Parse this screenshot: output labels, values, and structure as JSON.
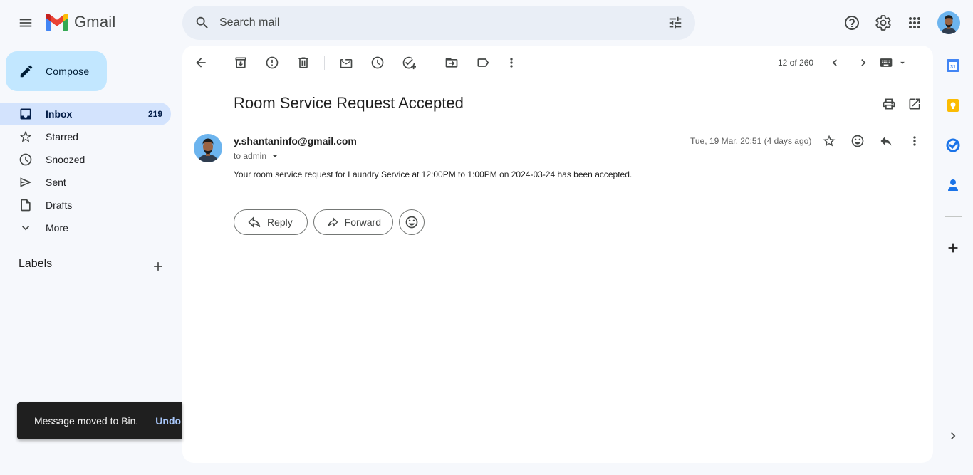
{
  "header": {
    "app_name": "Gmail",
    "search_placeholder": "Search mail"
  },
  "sidebar": {
    "compose_label": "Compose",
    "items": [
      {
        "label": "Inbox",
        "count": "219",
        "icon": "inbox-icon",
        "active": true
      },
      {
        "label": "Starred",
        "count": "",
        "icon": "star-icon"
      },
      {
        "label": "Snoozed",
        "count": "",
        "icon": "clock-icon"
      },
      {
        "label": "Sent",
        "count": "",
        "icon": "send-icon"
      },
      {
        "label": "Drafts",
        "count": "",
        "icon": "draft-icon"
      },
      {
        "label": "More",
        "count": "",
        "icon": "chevron-down-icon"
      }
    ],
    "labels_title": "Labels"
  },
  "toolbar": {
    "page_count": "12 of 260"
  },
  "message": {
    "subject": "Room Service Request Accepted",
    "sender": "y.shantaninfo@gmail.com",
    "recipient": "to admin",
    "date": "Tue, 19 Mar, 20:51 (4 days ago)",
    "body": "Your room service request for Laundry Service at 12:00PM to 1:00PM on 2024-03-24 has been accepted.",
    "reply_label": "Reply",
    "forward_label": "Forward"
  },
  "snackbar": {
    "text": "Message moved to Bin.",
    "action": "Undo"
  },
  "colors": {
    "background": "#f6f8fc",
    "compose": "#c2e7ff",
    "active_nav": "#d3e3fd",
    "search": "#e9eef6"
  }
}
